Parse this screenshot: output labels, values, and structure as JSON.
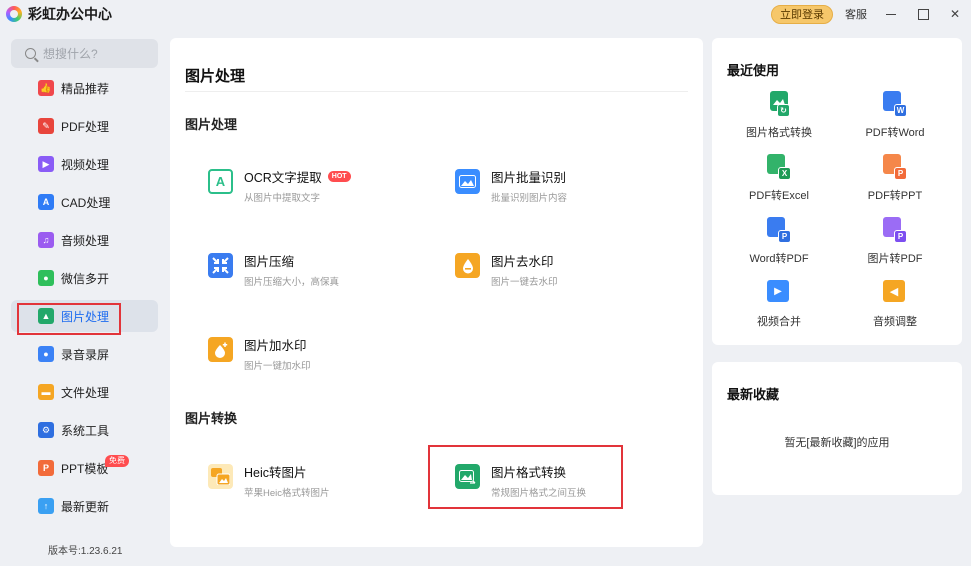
{
  "app": {
    "title": "彩虹办公中心",
    "login_label": "立即登录",
    "service_label": "客服"
  },
  "sidebar": {
    "search_placeholder": "想搜什么?",
    "items": [
      {
        "label": "精品推荐",
        "icon": "thumb-up-icon",
        "color": "#f0484c"
      },
      {
        "label": "PDF处理",
        "icon": "pdf-icon",
        "color": "#e8453c"
      },
      {
        "label": "视频处理",
        "icon": "video-icon",
        "color": "#8a5cf6"
      },
      {
        "label": "CAD处理",
        "icon": "cad-icon",
        "color": "#2f7cf6"
      },
      {
        "label": "音频处理",
        "icon": "music-icon",
        "color": "#9b5cf0"
      },
      {
        "label": "微信多开",
        "icon": "wechat-icon",
        "color": "#2fbf5b"
      },
      {
        "label": "图片处理",
        "icon": "image-icon",
        "color": "#22a86a"
      },
      {
        "label": "录音录屏",
        "icon": "microphone-icon",
        "color": "#3b82f6"
      },
      {
        "label": "文件处理",
        "icon": "folder-icon",
        "color": "#f5a623"
      },
      {
        "label": "系统工具",
        "icon": "gear-icon",
        "color": "#2f6fe0"
      },
      {
        "label": "PPT模板",
        "icon": "ppt-icon",
        "color": "#f26b3a",
        "badge": "免费"
      },
      {
        "label": "最新更新",
        "icon": "upload-icon",
        "color": "#3aa0f2"
      }
    ],
    "version": "版本号:1.23.6.21"
  },
  "main": {
    "title": "图片处理",
    "sections": [
      {
        "title": "图片处理"
      },
      {
        "title": "图片转换"
      }
    ],
    "cards": [
      {
        "title": "OCR文字提取",
        "desc": "从图片中提取文字",
        "hot": "HOT"
      },
      {
        "title": "图片批量识别",
        "desc": "批量识别图片内容"
      },
      {
        "title": "图片压缩",
        "desc": "图片压缩大小，高保真"
      },
      {
        "title": "图片去水印",
        "desc": "图片一键去水印"
      },
      {
        "title": "图片加水印",
        "desc": "图片一键加水印"
      },
      {
        "title": "Heic转图片",
        "desc": "苹果Heic格式转图片"
      },
      {
        "title": "图片格式转换",
        "desc": "常规图片格式之间互换"
      }
    ]
  },
  "recent": {
    "title": "最近使用",
    "tools": [
      {
        "label": "图片格式转换"
      },
      {
        "label": "PDF转Word",
        "sub": "W"
      },
      {
        "label": "PDF转Excel",
        "sub": "X"
      },
      {
        "label": "PDF转PPT",
        "sub": "P"
      },
      {
        "label": "Word转PDF",
        "sub": "P"
      },
      {
        "label": "图片转PDF",
        "sub": "P"
      },
      {
        "label": "视频合并"
      },
      {
        "label": "音频调整"
      }
    ]
  },
  "favorites": {
    "title": "最新收藏",
    "empty": "暂无[最新收藏]的应用"
  },
  "colors": {
    "accent": "#1e6cf0",
    "highlight": "#e2343a",
    "hot": "#ff4d4f"
  }
}
